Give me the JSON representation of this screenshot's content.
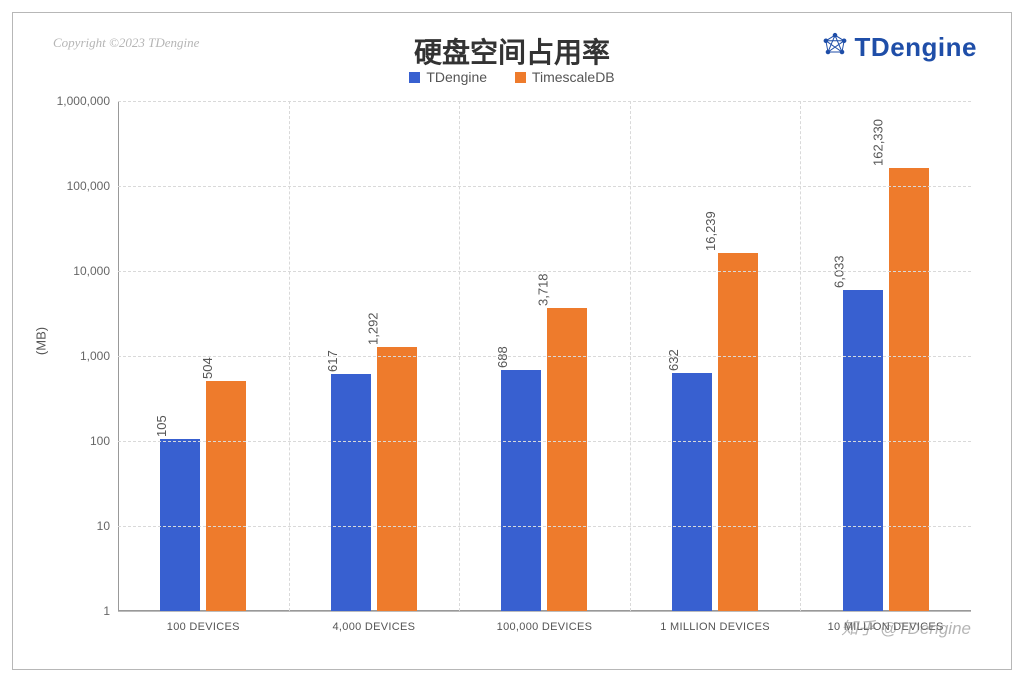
{
  "copyright": "Copyright ©2023 TDengine",
  "brand": "TDengine",
  "chart_data": {
    "type": "bar",
    "title": "硬盘空间占用率",
    "ylabel": "(MB)",
    "xlabel": "",
    "ylim": [
      1,
      1000000
    ],
    "yscale": "log",
    "yticks": [
      1,
      10,
      100,
      1000,
      10000,
      100000,
      1000000
    ],
    "ytick_labels": [
      "1",
      "10",
      "100",
      "1,000",
      "10,000",
      "100,000",
      "1,000,000"
    ],
    "categories": [
      "100 DEVICES",
      "4,000 DEVICES",
      "100,000 DEVICES",
      "1 MILLION DEVICES",
      "10 MILLION DEVICES"
    ],
    "series": [
      {
        "name": "TDengine",
        "color": "#3860d0",
        "values": [
          105,
          617,
          688,
          632,
          6033
        ],
        "value_labels": [
          "105",
          "617",
          "688",
          "632",
          "6,033"
        ]
      },
      {
        "name": "TimescaleDB",
        "color": "#ee7b2c",
        "values": [
          504,
          1292,
          3718,
          16239,
          162330
        ],
        "value_labels": [
          "504",
          "1,292",
          "3,718",
          "16,239",
          "162,330"
        ]
      }
    ]
  },
  "watermark": "知乎 @TDengine"
}
